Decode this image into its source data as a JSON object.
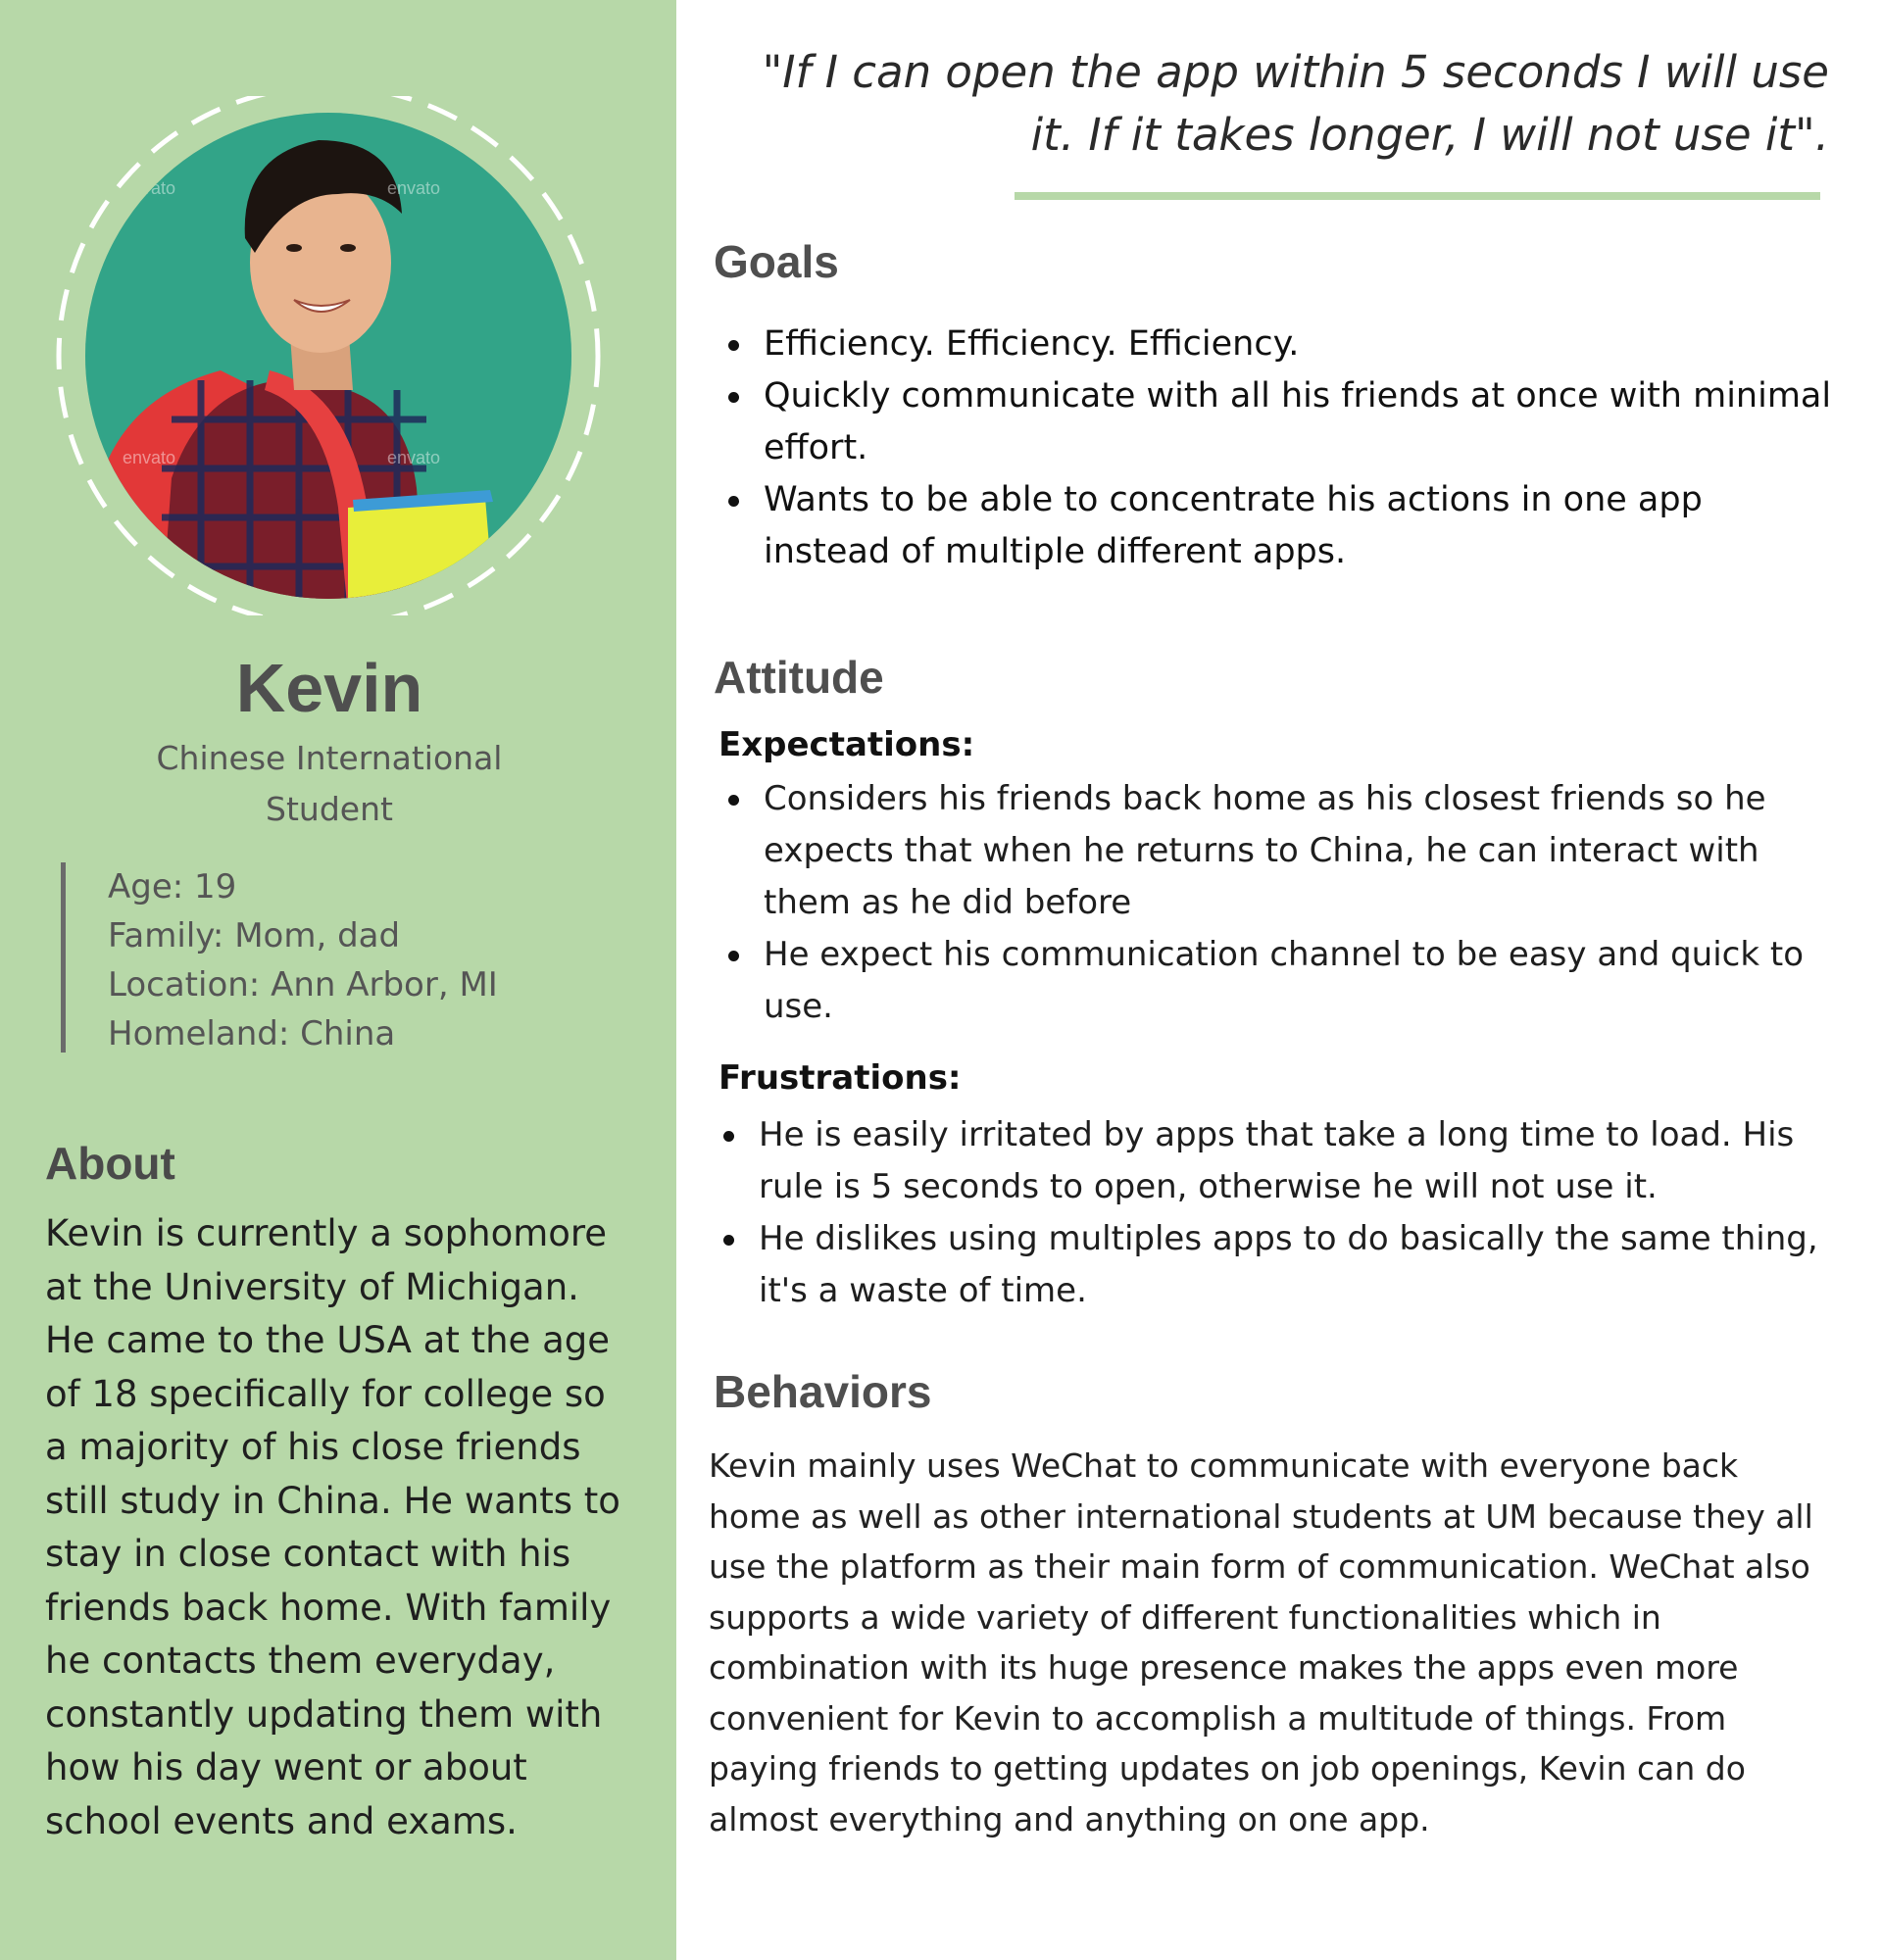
{
  "persona": {
    "name": "Kevin",
    "role": "Chinese International Student",
    "facts": [
      "Age: 19",
      "Family: Mom, dad",
      "Location: Ann Arbor, MI",
      "Homeland: China"
    ],
    "photo_watermark": "envato"
  },
  "about": {
    "heading": "About",
    "text": "Kevin is currently a sophomore at the University of Michigan. He came to the USA at the age of 18 specifically for college so a majority of his close friends still study in China. He wants to stay in close contact with his friends back home. With family he contacts them everyday, constantly updating them with how his day went or about school events and exams."
  },
  "quote": "\"If I can open the app within 5 seconds I will use it. If it takes longer, I will not use it\".",
  "goals": {
    "heading": "Goals",
    "items": [
      "Efficiency. Efficiency. Efficiency.",
      "Quickly communicate with all his friends at once with minimal effort.",
      "Wants to be able to concentrate his actions in one app instead of multiple different apps."
    ]
  },
  "attitude": {
    "heading": "Attitude",
    "expectations_heading": "Expectations:",
    "expectations": [
      "Considers his friends back home as his closest friends so he expects that when he returns to China, he can interact with them as he did before",
      "He expect his communication channel to be easy and quick to use."
    ],
    "frustrations_heading": "Frustrations:",
    "frustrations": [
      "He is easily irritated by apps that take a long time to load. His rule is 5 seconds to open, otherwise he will not use it.",
      "He dislikes using multiples apps to do basically the same thing, it's a waste of time."
    ]
  },
  "behaviors": {
    "heading": "Behaviors",
    "text": "Kevin mainly uses WeChat to communicate with everyone back home as well as other international students at UM because they all use the platform as their main form of communication. WeChat also supports a wide variety of different functionalities which in combination with its huge presence makes the apps even more convenient for Kevin to accomplish a multitude of things. From paying friends to getting updates on job openings, Kevin can do almost everything and anything on one app."
  },
  "colors": {
    "sidebar_bg": "#b7d8a8",
    "heading_gray": "#4f4f4f",
    "photo_bg": "#2f9f84",
    "accent_rule": "#b7d8a8"
  }
}
